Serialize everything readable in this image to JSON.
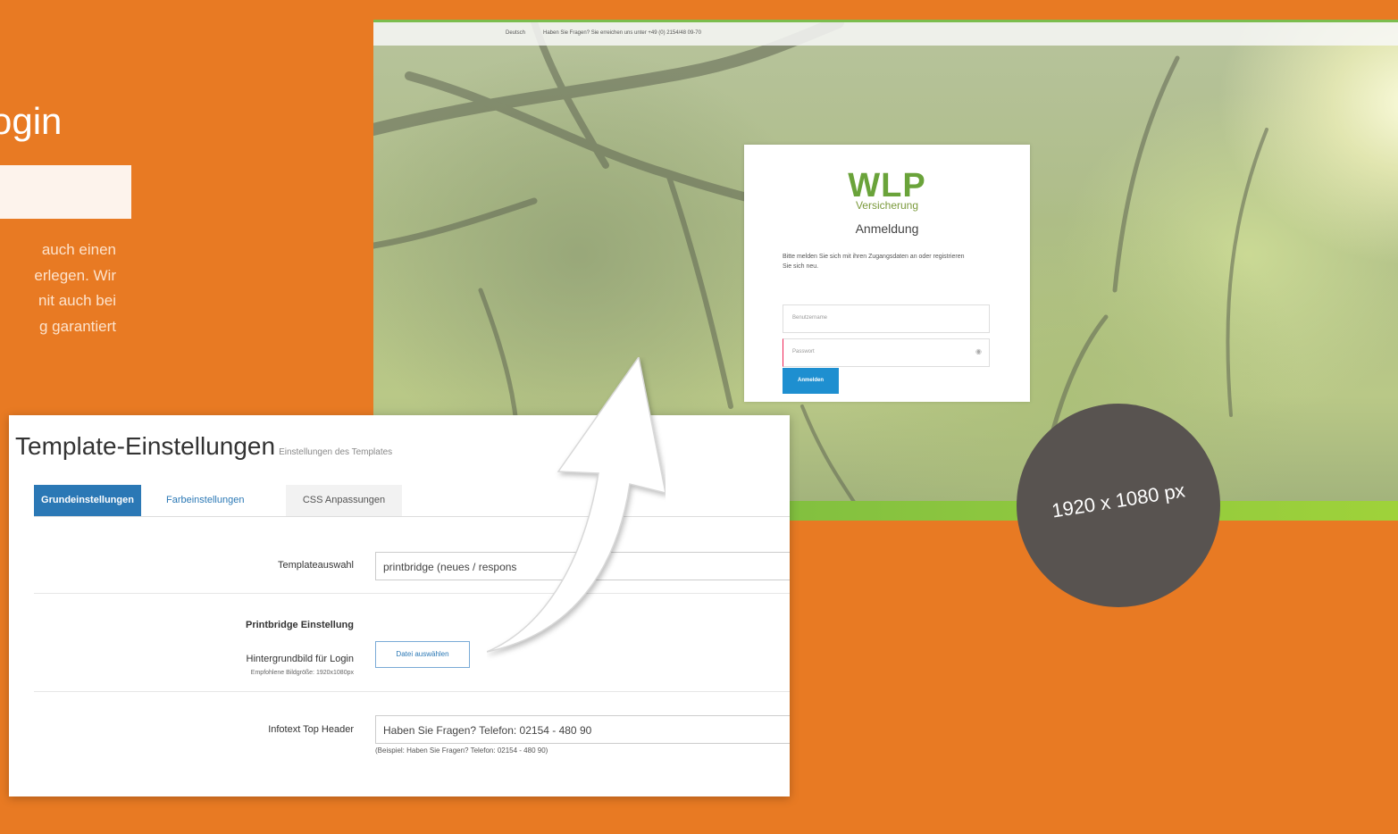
{
  "left": {
    "title": "ogin",
    "paragraph_lines": [
      "auch einen",
      "erlegen. Wir",
      "nit auch bei",
      "g garantiert"
    ]
  },
  "login_screen": {
    "topbar_language": "Deutsch",
    "topbar_info": "Haben Sie Fragen? Sie erreichen uns unter +49 (0) 2154/48 09-70",
    "logo_text": "WLP",
    "logo_sub": "Versicherung",
    "heading": "Anmeldung",
    "hint": "Bitte melden Sie sich mit ihren Zugangsdaten an oder registrieren Sie sich neu.",
    "username_placeholder": "Benutzername",
    "password_placeholder": "Passwort",
    "login_button": "Anmelden"
  },
  "badge": {
    "text": "1920 x 1080 px"
  },
  "template_settings": {
    "title": "Template-Einstellungen",
    "subtitle": "Einstellungen des Templates",
    "tabs": [
      "Grundeinstellungen",
      "Farbeinstellungen",
      "CSS Anpassungen"
    ],
    "active_tab": "Grundeinstellungen",
    "template_label": "Templateauswahl",
    "template_value": "printbridge (neues / respons",
    "section_heading": "Printbridge Einstellung",
    "bg_label": "Hintergrundbild für Login",
    "bg_hint": "Empfohlene Bildgröße: 1920x1080px",
    "file_button": "Datei auswählen",
    "infotext_label": "Infotext Top Header",
    "infotext_value": "Haben Sie Fragen? Telefon: 02154 - 480 90",
    "infotext_hint": "(Beispiel: Haben Sie Fragen? Telefon: 02154 - 480 90)"
  },
  "colors": {
    "background": "#e87a23",
    "badge": "#585350",
    "accent_blue": "#2b78b5",
    "wlp_green": "#6aa33a"
  }
}
